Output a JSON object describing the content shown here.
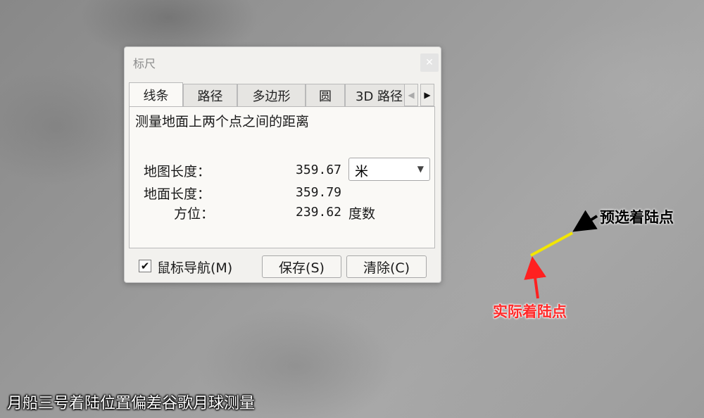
{
  "dialog": {
    "title": "标尺",
    "close_icon": "close-icon",
    "tabs": [
      {
        "label": "线条",
        "active": true
      },
      {
        "label": "路径",
        "active": false
      },
      {
        "label": "多边形",
        "active": false
      },
      {
        "label": "圆",
        "active": false
      },
      {
        "label": "3D 路径",
        "active": false
      }
    ],
    "scroll_left_icon": "triangle-left-icon",
    "scroll_right_icon": "triangle-right-icon",
    "description": "测量地面上两个点之间的距离",
    "map_length": {
      "label": "地图长度：",
      "value": "359.67"
    },
    "unit_select": {
      "value": "米"
    },
    "ground_length": {
      "label": "地面长度：",
      "value": "359.79"
    },
    "heading": {
      "label": "方位：",
      "value": "239.62",
      "unit": "度数"
    },
    "mouse_nav": {
      "label": "鼠标导航(M)",
      "checked": true
    },
    "save_label": "保存(S)",
    "clear_label": "清除(C)"
  },
  "annotations": {
    "planned": {
      "text": "预选着陆点",
      "color": "#000000"
    },
    "actual": {
      "text": "实际着陆点",
      "color": "#ff2a2a"
    },
    "line_color": "#f2e600"
  },
  "caption": "月船三号着陆位置偏差谷歌月球测量"
}
